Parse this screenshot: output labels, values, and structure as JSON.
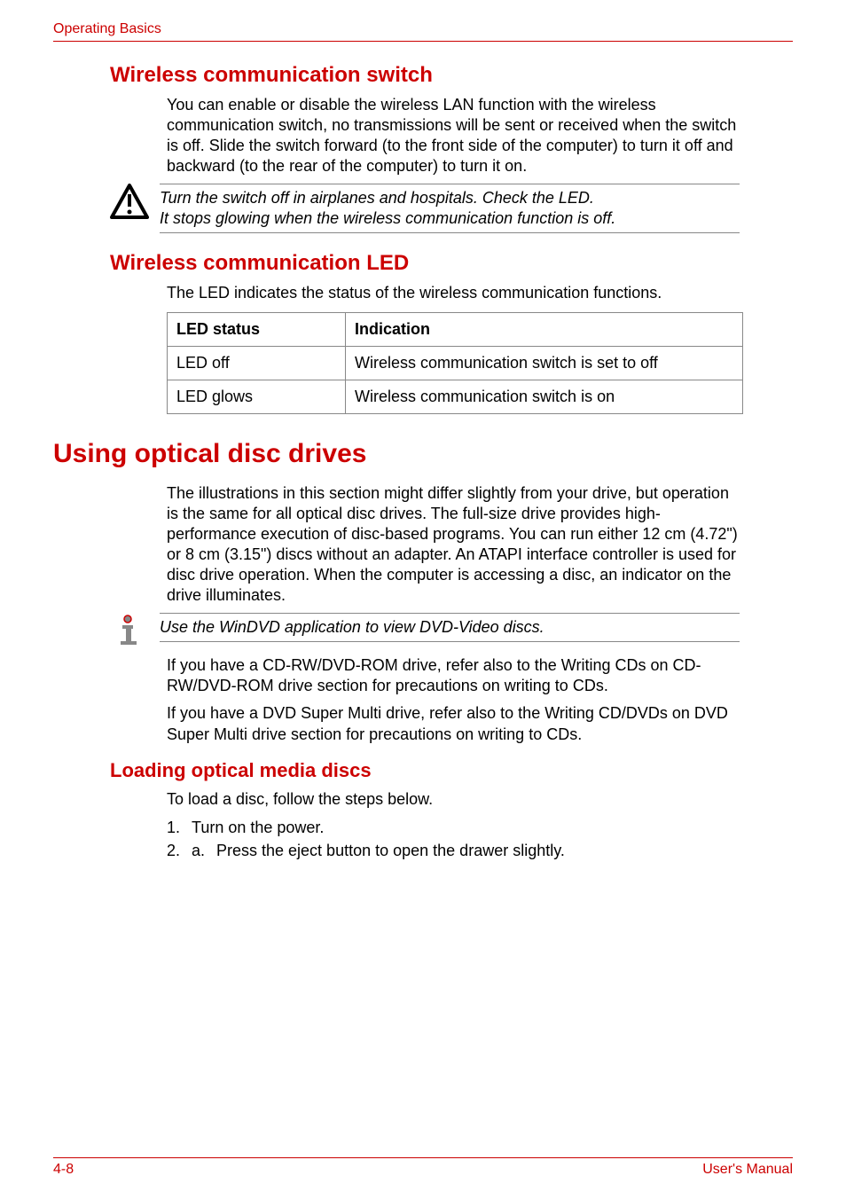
{
  "header": {
    "running": "Operating Basics"
  },
  "sections": {
    "wireless_switch": {
      "title": "Wireless communication switch",
      "body": "You can enable or disable the wireless LAN function with the wireless communication switch, no transmissions will be sent or received when the switch is off. Slide the switch forward (to the front side of the computer) to turn it off and backward (to the rear of the computer) to turn it on.",
      "warning_line1": "Turn the switch off in airplanes and hospitals. Check the LED.",
      "warning_line2": "It stops glowing when the wireless communication function is off."
    },
    "wireless_led": {
      "title": "Wireless communication LED",
      "body": "The LED indicates the status of the wireless communication functions.",
      "table": {
        "headers": [
          "LED status",
          "Indication"
        ],
        "rows": [
          [
            "LED off",
            "Wireless communication switch is set to off"
          ],
          [
            "LED glows",
            "Wireless communication switch is on"
          ]
        ]
      }
    },
    "optical": {
      "title": "Using optical disc drives",
      "body": "The illustrations in this section might differ slightly from your drive, but operation is the same for all optical disc drives. The full-size drive provides high-performance execution of disc-based programs. You can run either 12 cm (4.72\") or 8 cm (3.15\") discs without an adapter. An ATAPI interface controller is used for disc drive operation. When the computer is accessing a disc, an indicator on the drive illuminates.",
      "info_note": "Use the WinDVD application to view DVD-Video discs.",
      "after1": "If you have a CD-RW/DVD-ROM drive, refer also to the Writing CDs on CD-RW/DVD-ROM drive section for precautions on writing to CDs.",
      "after2": "If you have a DVD Super Multi drive, refer also to the Writing CD/DVDs on DVD Super Multi drive section for precautions on writing to CDs."
    },
    "loading": {
      "title": "Loading optical media discs",
      "body": "To load a disc, follow the steps below.",
      "steps": {
        "s1_num": "1.",
        "s1_text": "Turn on the power.",
        "s2_num": "2.",
        "s2_sub": "a.",
        "s2_text": "Press the eject button to open the drawer slightly."
      }
    }
  },
  "footer": {
    "page": "4-8",
    "manual": "User's Manual"
  }
}
